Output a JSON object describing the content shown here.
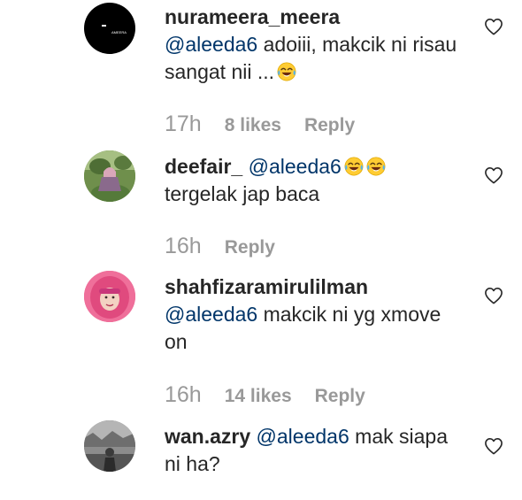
{
  "comments": [
    {
      "username": "nurameera_meera",
      "mention": "@aleeda6",
      "text": "adoiii, makcik ni risau sangat nii ...",
      "time": "17h",
      "likes": "8 likes",
      "reply": "Reply",
      "avatar_text": "AMEERA"
    },
    {
      "username": "deefair_",
      "mention": "@aleeda6",
      "text": "tergelak jap baca",
      "time": "16h",
      "likes": "",
      "reply": "Reply"
    },
    {
      "username": "shahfizaramirulilman",
      "mention": "@aleeda6",
      "text": "makcik ni yg xmove on",
      "time": "16h",
      "likes": "14 likes",
      "reply": "Reply"
    },
    {
      "username": "wan.azry",
      "mention": "@aleeda6",
      "text": "mak siapa ni ha?",
      "time": "",
      "likes": "",
      "reply": ""
    }
  ],
  "icons": {
    "like": "heart-outline-icon",
    "laugh": "tears-of-joy-emoji"
  },
  "colors": {
    "mention": "#003569",
    "meta": "#999999",
    "text": "#262626"
  }
}
